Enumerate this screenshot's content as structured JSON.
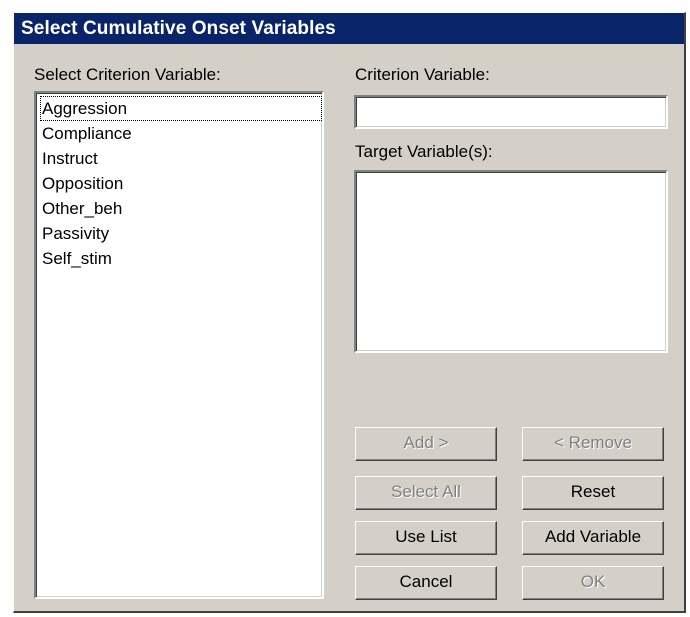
{
  "window": {
    "title": "Select Cumulative Onset Variables"
  },
  "criterion_list": {
    "label": "Select Criterion Variable:",
    "items": [
      "Aggression",
      "Compliance",
      "Instruct",
      "Opposition",
      "Other_beh",
      "Passivity",
      "Self_stim"
    ]
  },
  "criterion_variable": {
    "label": "Criterion Variable:",
    "value": ""
  },
  "target_variables": {
    "label": "Target Variable(s):",
    "items": []
  },
  "buttons": {
    "add": "Add >",
    "remove": "< Remove",
    "select_all": "Select All",
    "reset": "Reset",
    "use_list": "Use List",
    "add_variable": "Add Variable",
    "cancel": "Cancel",
    "ok": "OK"
  }
}
